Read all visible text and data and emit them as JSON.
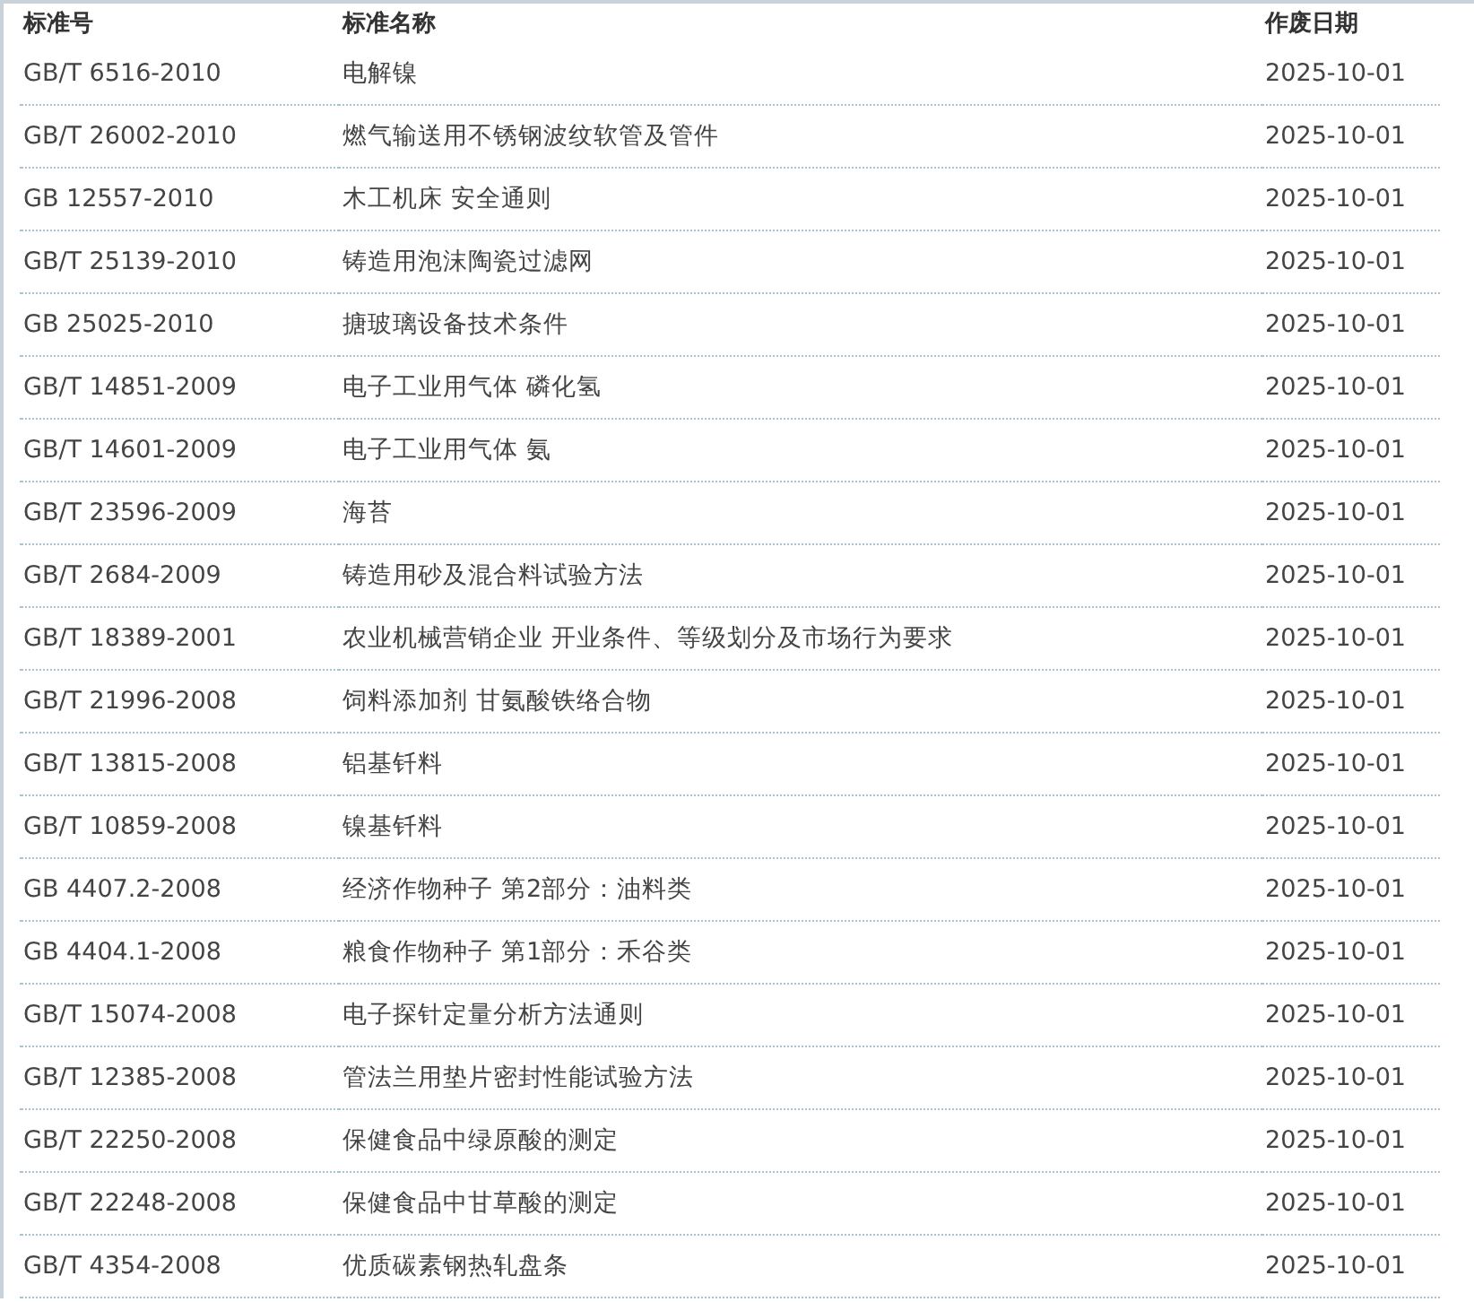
{
  "table": {
    "columns": [
      "标准号",
      "标准名称",
      "作废日期"
    ],
    "rows": [
      {
        "code": "GB/T 6516-2010",
        "name": "电解镍",
        "date": "2025-10-01"
      },
      {
        "code": "GB/T 26002-2010",
        "name": "燃气输送用不锈钢波纹软管及管件",
        "date": "2025-10-01"
      },
      {
        "code": "GB 12557-2010",
        "name": "木工机床 安全通则",
        "date": "2025-10-01"
      },
      {
        "code": "GB/T 25139-2010",
        "name": "铸造用泡沫陶瓷过滤网",
        "date": "2025-10-01"
      },
      {
        "code": "GB 25025-2010",
        "name": "搪玻璃设备技术条件",
        "date": "2025-10-01"
      },
      {
        "code": "GB/T 14851-2009",
        "name": "电子工业用气体 磷化氢",
        "date": "2025-10-01"
      },
      {
        "code": "GB/T 14601-2009",
        "name": "电子工业用气体 氨",
        "date": "2025-10-01"
      },
      {
        "code": "GB/T 23596-2009",
        "name": "海苔",
        "date": "2025-10-01"
      },
      {
        "code": "GB/T 2684-2009",
        "name": "铸造用砂及混合料试验方法",
        "date": "2025-10-01"
      },
      {
        "code": "GB/T 18389-2001",
        "name": "农业机械营销企业 开业条件、等级划分及市场行为要求",
        "date": "2025-10-01"
      },
      {
        "code": "GB/T 21996-2008",
        "name": "饲料添加剂 甘氨酸铁络合物",
        "date": "2025-10-01"
      },
      {
        "code": "GB/T 13815-2008",
        "name": "铝基钎料",
        "date": "2025-10-01"
      },
      {
        "code": "GB/T 10859-2008",
        "name": "镍基钎料",
        "date": "2025-10-01"
      },
      {
        "code": "GB 4407.2-2008",
        "name": "经济作物种子 第2部分：油料类",
        "date": "2025-10-01"
      },
      {
        "code": "GB 4404.1-2008",
        "name": "粮食作物种子 第1部分：禾谷类",
        "date": "2025-10-01"
      },
      {
        "code": "GB/T 15074-2008",
        "name": "电子探针定量分析方法通则",
        "date": "2025-10-01"
      },
      {
        "code": "GB/T 12385-2008",
        "name": "管法兰用垫片密封性能试验方法",
        "date": "2025-10-01"
      },
      {
        "code": "GB/T 22250-2008",
        "name": "保健食品中绿原酸的测定",
        "date": "2025-10-01"
      },
      {
        "code": "GB/T 22248-2008",
        "name": "保健食品中甘草酸的测定",
        "date": "2025-10-01"
      },
      {
        "code": "GB/T 4354-2008",
        "name": "优质碳素钢热轧盘条",
        "date": "2025-10-01"
      }
    ]
  }
}
